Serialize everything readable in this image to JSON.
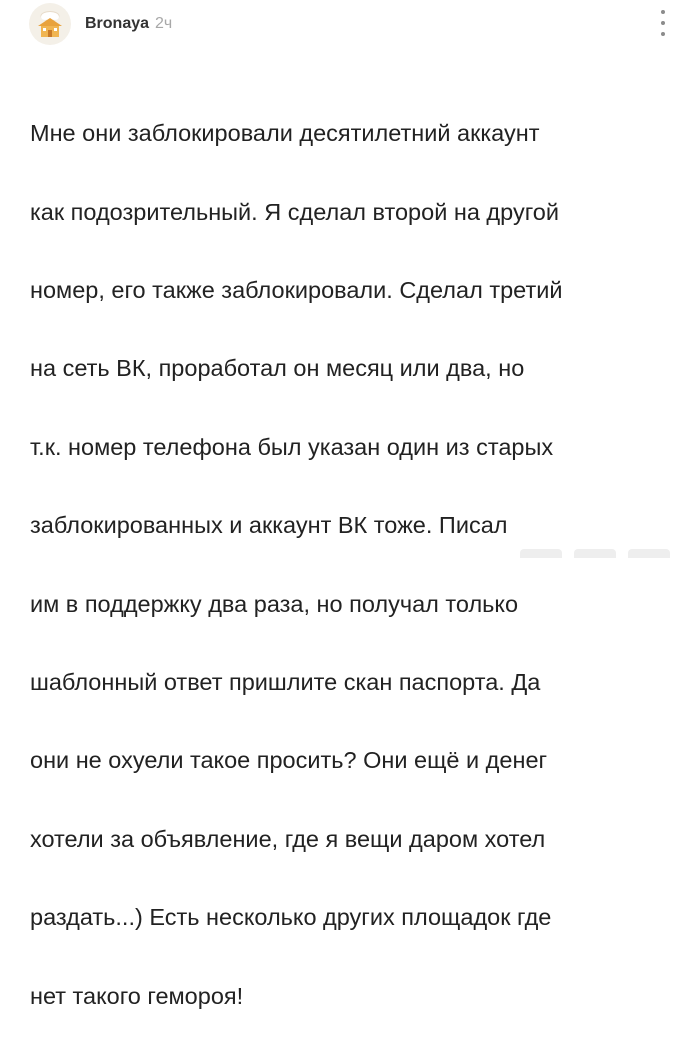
{
  "comment": {
    "author": {
      "username": "Bronaya",
      "time": "2ч",
      "avatar_icon": "avatar-house-icon"
    },
    "body_lines": [
      "Мне они заблокировали десятилетний аккаунт",
      "как подозрительный. Я сделал второй на другой",
      "номер, его также заблокировали. Сделал третий",
      "на сеть ВК, проработал он месяц или два, но",
      "т.к. номер телефона был указан один из старых",
      "заблокированных и аккаунт ВК тоже. Писал",
      "им в поддержку два раза, но получал только",
      "шаблонный ответ пришлите скан паспорта. Да",
      "они не охуели такое просить? Они ещё и денег",
      "хотели за объявление, где я вещи даром хотел",
      "раздать...) Есть несколько других площадок где",
      "нет такого гемороя!"
    ],
    "menu_icon": "more-vertical-icon"
  },
  "colors": {
    "text": "#222222",
    "username": "#333333",
    "time": "#a8a8a8",
    "menu_dots": "#8c8c8c",
    "avatar_bg": "#f4f0e8"
  }
}
